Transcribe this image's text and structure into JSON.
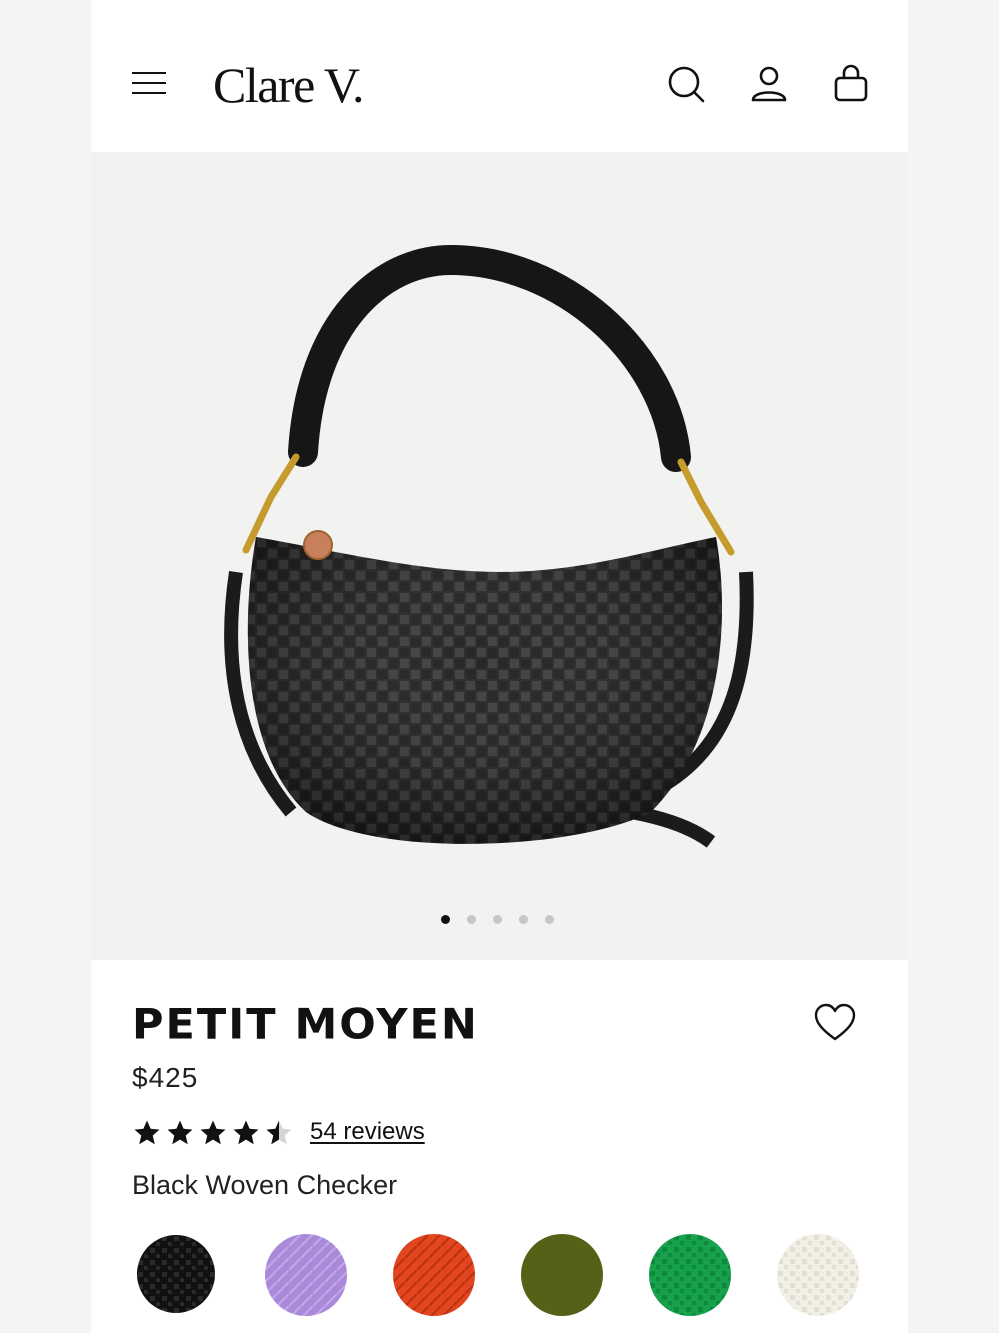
{
  "brand": {
    "logo_text": "Clare V."
  },
  "header": {
    "icons": [
      "menu-icon",
      "search-icon",
      "account-icon",
      "shopping-bag-icon"
    ]
  },
  "carousel": {
    "slide_count": 5,
    "active_index": 0
  },
  "product": {
    "title": "PETIT MOYEN",
    "price": "$425",
    "rating": 4.5,
    "rating_max": 5,
    "reviews_label": "54 reviews",
    "color_name": "Black Woven Checker"
  },
  "swatches": [
    {
      "color": "#1a1a1a",
      "selected": true
    },
    {
      "color": "#a98ad9",
      "selected": false
    },
    {
      "color": "#e2451f",
      "selected": false
    },
    {
      "color": "#546116",
      "selected": false
    },
    {
      "color": "#17a14c",
      "selected": false
    },
    {
      "color": "#f1efe6",
      "selected": false
    }
  ]
}
